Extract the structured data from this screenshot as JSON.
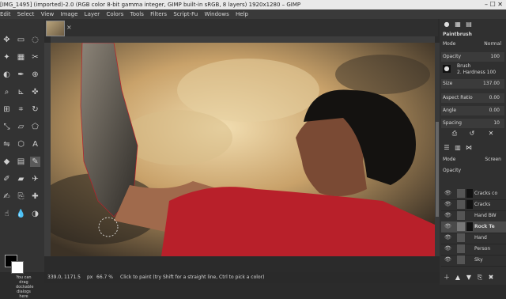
{
  "window": {
    "title": "[IMG_1495] (imported)-2.0 (RGB color 8-bit gamma integer, GIMP built-in sRGB, 8 layers) 1920x1280 – GIMP",
    "controls": "–  ☐  ✕"
  },
  "menu": [
    "Edit",
    "Select",
    "View",
    "Image",
    "Layer",
    "Colors",
    "Tools",
    "Filters",
    "Script-Fu",
    "Windows",
    "Help"
  ],
  "toolbox": {
    "hint": "You can drag dockable dialogs here"
  },
  "image_tab": {
    "close": "×"
  },
  "statusbar": {
    "coords": "339.0, 1171.5",
    "unit": "px",
    "zoom": "66.7 %",
    "message": "Click to paint (try Shift for a straight line, Ctrl to pick a color)"
  },
  "tool_options": {
    "title": "Paintbrush",
    "mode_label": "Mode",
    "mode_value": "Normal",
    "opacity_label": "Opacity",
    "opacity_value": "100",
    "brush_label": "Brush",
    "brush_value": "2. Hardness 100",
    "size_label": "Size",
    "size_value": "137.00",
    "aspect_label": "Aspect Ratio",
    "aspect_value": "0.00",
    "angle_label": "Angle",
    "angle_value": "0.00",
    "spacing_label": "Spacing",
    "spacing_value": "10"
  },
  "layers_panel": {
    "mode_label": "Mode",
    "mode_value": "Screen",
    "opacity_label": "Opacity",
    "layers": [
      {
        "name": "Cracks co",
        "selected": false
      },
      {
        "name": "Cracks",
        "selected": false
      },
      {
        "name": "Hand BW",
        "selected": false
      },
      {
        "name": "Rock Te",
        "selected": true
      },
      {
        "name": "Hand",
        "selected": false
      },
      {
        "name": "Person",
        "selected": false
      },
      {
        "name": "Sky",
        "selected": false
      }
    ]
  },
  "colors": {
    "accent_red": "#b8202a",
    "sky_gold": "#c9a26a",
    "panel_bg": "#303030"
  }
}
